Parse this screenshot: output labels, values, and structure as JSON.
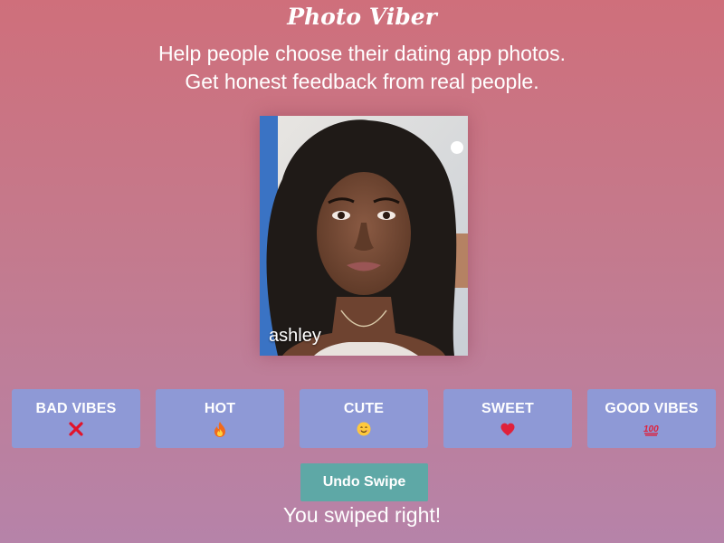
{
  "app": {
    "title": "Photo Viber",
    "tagline_line1": "Help people choose their dating app photos.",
    "tagline_line2": "Get honest feedback from real people."
  },
  "photo": {
    "name": "ashley"
  },
  "vote_buttons": [
    {
      "label": "BAD VIBES",
      "icon": "cross-mark-icon"
    },
    {
      "label": "HOT",
      "icon": "fire-icon"
    },
    {
      "label": "CUTE",
      "icon": "smiling-face-icon"
    },
    {
      "label": "SWEET",
      "icon": "red-heart-icon"
    },
    {
      "label": "GOOD VIBES",
      "icon": "hundred-points-icon"
    }
  ],
  "undo": {
    "label": "Undo Swipe"
  },
  "status": {
    "text": "You swiped right!"
  },
  "colors": {
    "background_top": "#cf6f7b",
    "background_bottom": "#b683a9",
    "vote_button": "#8e99d6",
    "undo_button": "#5ea8a6",
    "text": "#ffffff"
  }
}
